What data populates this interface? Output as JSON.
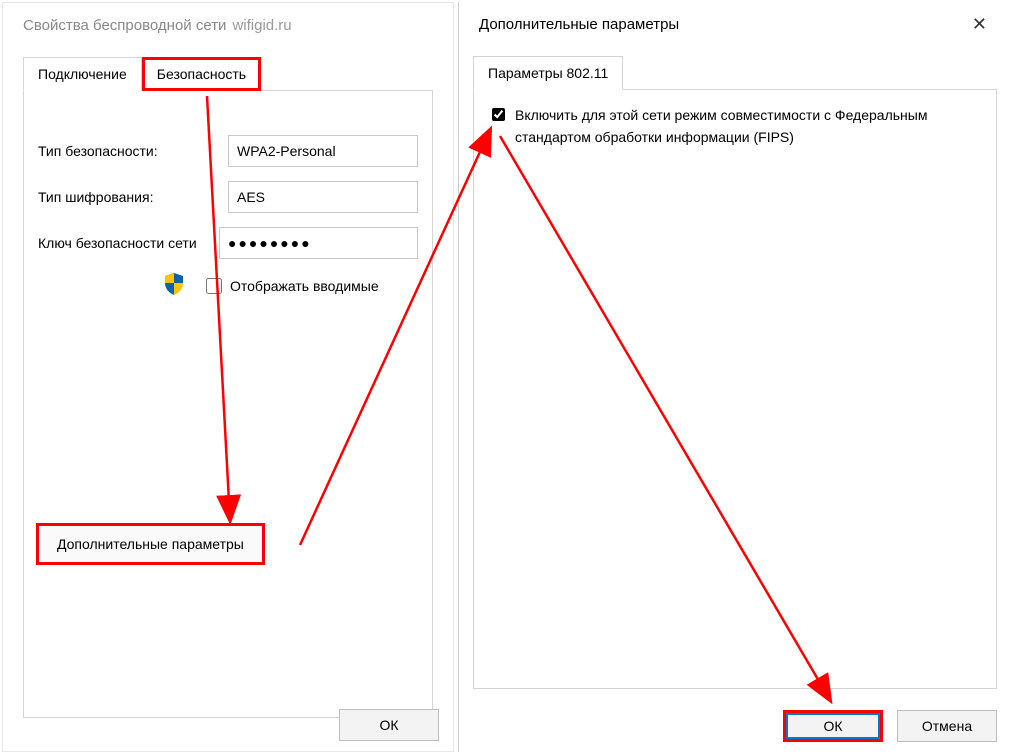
{
  "left_dialog": {
    "title": "Свойства беспроводной сети",
    "subtitle": "wifigid.ru",
    "tabs": {
      "connection": "Подключение",
      "security": "Безопасность"
    },
    "form": {
      "security_type_label": "Тип безопасности:",
      "security_type_value": "WPA2-Personal",
      "encryption_type_label": "Тип шифрования:",
      "encryption_type_value": "AES",
      "key_label": "Ключ безопасности сети",
      "key_value": "●●●●●●●●",
      "show_chars_label": "Отображать вводимые"
    },
    "advanced_button": "Дополнительные параметры",
    "ok_button": "ОК"
  },
  "right_dialog": {
    "title": "Дополнительные параметры",
    "tab": "Параметры 802.11",
    "fips_label": "Включить для этой сети режим совместимости с Федеральным стандартом обработки информации (FIPS)",
    "ok_button": "ОК",
    "cancel_button": "Отмена"
  }
}
